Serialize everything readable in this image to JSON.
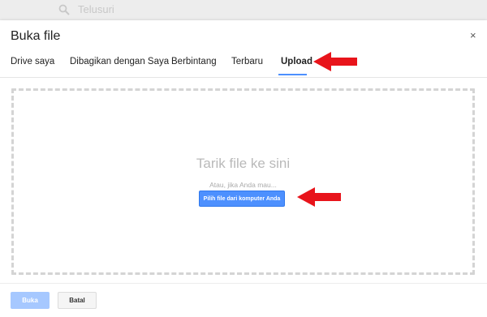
{
  "background": {
    "search_placeholder": "Telusuri",
    "search_icon": "search-icon"
  },
  "dialog": {
    "title": "Buka file",
    "close_label": "×",
    "tabs": [
      {
        "label": "Drive saya",
        "active": false
      },
      {
        "label": "Dibagikan dengan Saya",
        "active": false
      },
      {
        "label": "Berbintang",
        "active": false
      },
      {
        "label": "Terbaru",
        "active": false
      },
      {
        "label": "Upload",
        "active": true
      }
    ],
    "dropzone": {
      "title": "Tarik file ke sini",
      "subtitle": "Atau, jika Anda mau...",
      "pick_button": "Pilih file dari komputer Anda"
    },
    "footer": {
      "open_label": "Buka",
      "cancel_label": "Batal"
    }
  },
  "annotations": {
    "arrow_color": "#e8141b",
    "arrows": [
      "arrow-to-upload-tab",
      "arrow-to-pick-button"
    ]
  },
  "colors": {
    "accent": "#4d90fe",
    "disabled_primary": "#a6c8ff",
    "dashed_border": "#d4d4d4"
  }
}
